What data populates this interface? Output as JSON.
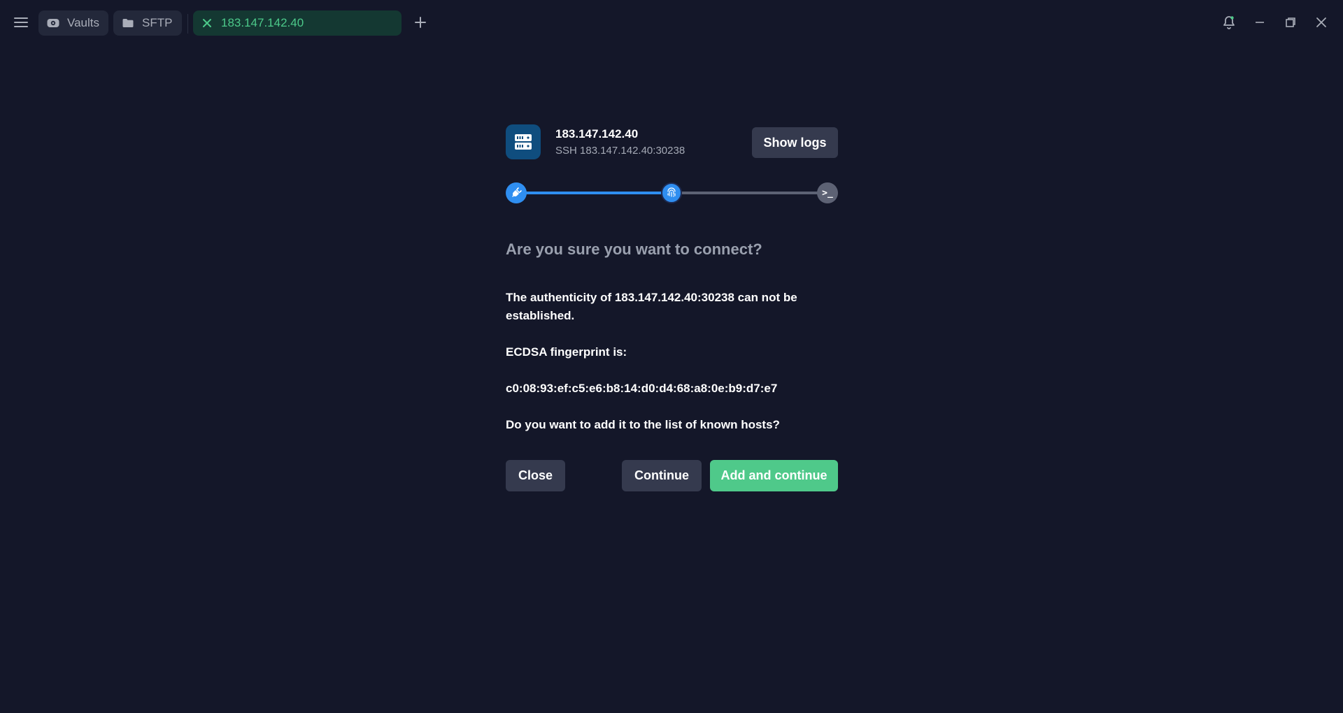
{
  "tabs": {
    "vaults": {
      "label": "Vaults",
      "icon": "vault-icon"
    },
    "sftp": {
      "label": "SFTP",
      "icon": "folder-icon"
    },
    "host": {
      "label": "183.147.142.40",
      "icon": "close-icon"
    }
  },
  "host": {
    "title": "183.147.142.40",
    "subtitle": "SSH 183.147.142.40:30238",
    "icon": "server-icon"
  },
  "show_logs_label": "Show logs",
  "stepper": {
    "steps": [
      {
        "icon": "plug-icon",
        "state": "done"
      },
      {
        "icon": "fingerprint-icon",
        "state": "active"
      },
      {
        "icon": "terminal-icon",
        "label": ">_",
        "state": "pending"
      }
    ]
  },
  "prompt": {
    "question": "Are you sure you want to connect?",
    "authenticity": "The authenticity of 183.147.142.40:30238 can not be established.",
    "fingerprint_label": "ECDSA fingerprint is:",
    "fingerprint": "c0:08:93:ef:c5:e6:b8:14:d0:d4:68:a8:0e:b9:d7:e7",
    "add_question": "Do you want to add it to the list of known hosts?"
  },
  "buttons": {
    "close": "Close",
    "continue": "Continue",
    "add_and_continue": "Add and continue"
  },
  "colors": {
    "background": "#141729",
    "accent_blue": "#2f8ef0",
    "accent_green": "#4fc98a",
    "button_gray": "#353a4e"
  }
}
